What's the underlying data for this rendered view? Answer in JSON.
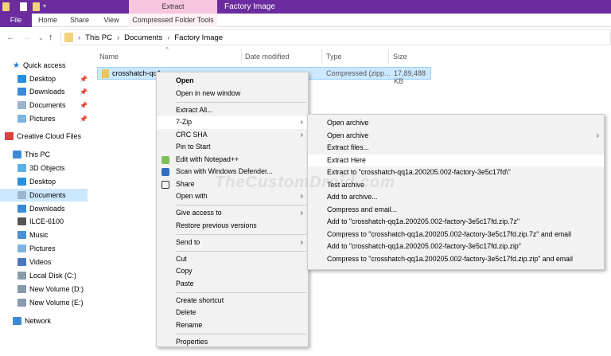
{
  "title": {
    "context_tab": "Extract",
    "window_title": "Factory Image"
  },
  "ribbon": {
    "tabs": [
      "File",
      "Home",
      "Share",
      "View"
    ],
    "context_tab": "Compressed Folder Tools"
  },
  "address": {
    "crumbs": [
      "This PC",
      "Documents",
      "Factory Image"
    ]
  },
  "columns": {
    "name": "Name",
    "date": "Date modified",
    "type": "Type",
    "size": "Size"
  },
  "file": {
    "name": "crosshatch-qq1",
    "type": "Compressed (zipp...",
    "size": "17,89,488 KB"
  },
  "sidebar": {
    "items": [
      "Quick access",
      "Desktop",
      "Downloads",
      "Documents",
      "Pictures",
      "Creative Cloud Files",
      "This PC",
      "3D Objects",
      "Desktop",
      "Documents",
      "Downloads",
      "ILCE-6100",
      "Music",
      "Pictures",
      "Videos",
      "Local Disk (C:)",
      "New Volume (D:)",
      "New Volume (E:)",
      "Network"
    ]
  },
  "context_menu": {
    "items": [
      "Open",
      "Open in new window",
      "Extract All...",
      "7-Zip",
      "CRC SHA",
      "Pin to Start",
      "Edit with Notepad++",
      "Scan with Windows Defender...",
      "Share",
      "Open with",
      "Give access to",
      "Restore previous versions",
      "Send to",
      "Cut",
      "Copy",
      "Paste",
      "Create shortcut",
      "Delete",
      "Rename",
      "Properties"
    ]
  },
  "submenu": {
    "items": [
      "Open archive",
      "Open archive",
      "Extract files...",
      "Extract Here",
      "Extract to \"crosshatch-qq1a.200205.002-factory-3e5c17fd\\\"",
      "Test archive",
      "Add to archive...",
      "Compress and email...",
      "Add to \"crosshatch-qq1a.200205.002-factory-3e5c17fd.zip.7z\"",
      "Compress to \"crosshatch-qq1a.200205.002-factory-3e5c17fd.zip.7z\" and email",
      "Add to \"crosshatch-qq1a.200205.002-factory-3e5c17fd.zip.zip\"",
      "Compress to \"crosshatch-qq1a.200205.002-factory-3e5c17fd.zip.zip\" and email"
    ]
  },
  "watermark": "TheCustomDroid.com",
  "colors": {
    "purple": "#6a2c9e",
    "pink": "#f7c5dd",
    "selection": "#cce8ff"
  }
}
